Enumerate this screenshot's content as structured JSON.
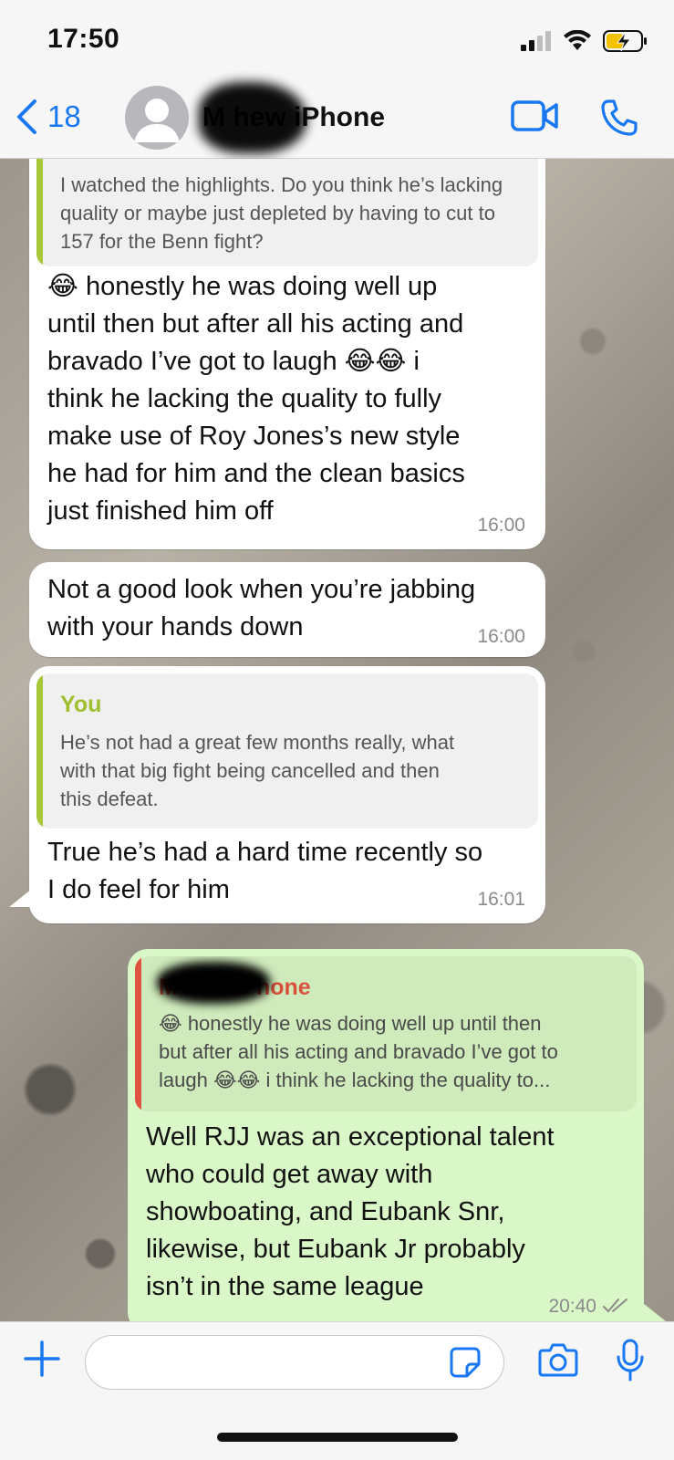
{
  "status_bar": {
    "time": "17:50"
  },
  "header": {
    "back_count": "18",
    "contact_name": "Matthew iPhone",
    "contact_name_visible": "M      hew iPhone"
  },
  "messages": [
    {
      "direction": "incoming",
      "quote_text": "I watched the highlights. Do you think he’s lacking quality or maybe just depleted by having to cut to 157 for the Benn fight?",
      "text_lines": [
        "😂 honestly he was doing well up",
        "until then but after all his acting and",
        "bravado I’ve got to laugh 😂😂 i",
        "think he lacking the quality to fully",
        "make use of Roy Jones’s new style",
        "he had for him and the clean basics",
        "just finished him off"
      ],
      "time": "16:00"
    },
    {
      "direction": "incoming",
      "text_lines": [
        "Not a good look when you’re jabbing",
        "with your hands down"
      ],
      "time": "16:00"
    },
    {
      "direction": "incoming",
      "quote_author": "You",
      "quote_text_lines": [
        "He’s not had a great few months really, what",
        "with that big fight being cancelled and then",
        "this defeat."
      ],
      "text_lines": [
        "True he’s had a hard time recently so",
        "I do feel for him"
      ],
      "time": "16:01"
    },
    {
      "direction": "outgoing",
      "quote_author": "M     hew iPhone",
      "quote_text_lines": [
        "😂 honestly he was doing well up until then",
        "but after all his acting and bravado I’ve got to",
        "laugh 😂😂 i think he lacking the quality to..."
      ],
      "text_lines": [
        "Well RJJ was an exceptional talent",
        "who could get away with",
        "showboating, and Eubank Snr,",
        "likewise, but Eubank Jr probably",
        "isn’t in the same league"
      ],
      "time": "20:40",
      "read_receipt": "double-check-icon"
    }
  ],
  "input_bar": {
    "placeholder": "",
    "value": ""
  },
  "colors": {
    "accent_blue": "#1877f2",
    "quote_bar_you": "#a8c83a",
    "quote_author_you": "#9fbf2f",
    "quote_bar_contact": "#e0533f",
    "quote_author_contact": "#d9503c",
    "outgoing_bubble": "#daf7c8",
    "incoming_bubble": "#ffffff"
  }
}
